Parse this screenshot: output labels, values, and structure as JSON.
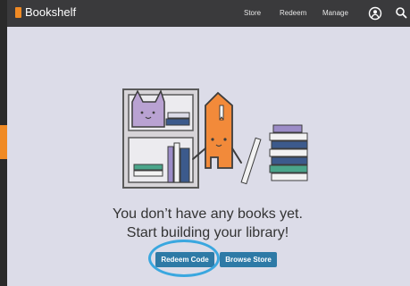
{
  "app": {
    "name": "Bookshelf",
    "brand_color": "#f08a24",
    "nav": [
      "Store",
      "Redeem",
      "Manage"
    ],
    "icons": [
      "book-icon",
      "account-icon",
      "search-icon"
    ]
  },
  "empty_state": {
    "line1": "You don’t have any books yet.",
    "line2": "Start building your library!",
    "actions": {
      "redeem_label": "Redeem Code",
      "browse_label": "Browse Store"
    }
  },
  "colors": {
    "topbar": "#3a3a3c",
    "button": "#2e7aa6",
    "highlight": "#3aa7df",
    "background": "#dcdce8"
  }
}
